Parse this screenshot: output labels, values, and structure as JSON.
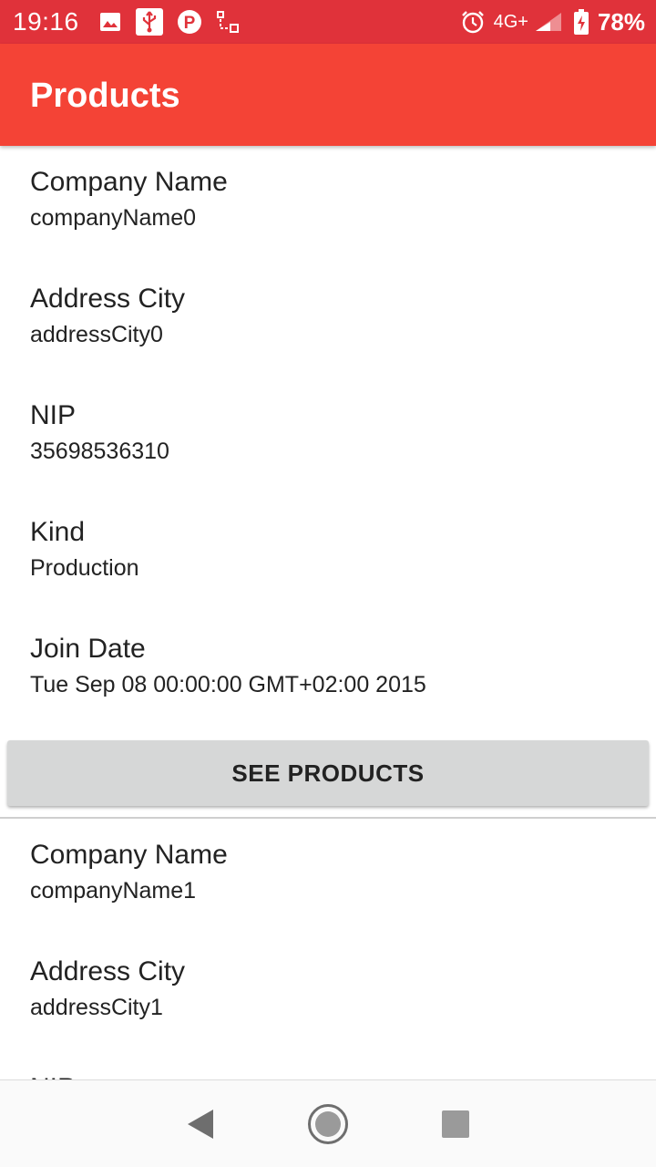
{
  "status_bar": {
    "time": "19:16",
    "network": "4G+",
    "battery": "78%",
    "left_icons": [
      "image-icon",
      "usb-icon",
      "parking-icon",
      "screencast-icon"
    ],
    "right_icons": [
      "alarm-icon",
      "signal-icon",
      "battery-charging-icon"
    ]
  },
  "app_bar": {
    "title": "Products",
    "color": "#f44336"
  },
  "companies": [
    {
      "fields": [
        {
          "label": "Company Name",
          "value": "companyName0"
        },
        {
          "label": "Address City",
          "value": "addressCity0"
        },
        {
          "label": "NIP",
          "value": "35698536310"
        },
        {
          "label": "Kind",
          "value": "Production"
        },
        {
          "label": "Join Date",
          "value": "Tue Sep 08 00:00:00 GMT+02:00 2015"
        }
      ],
      "button_label": "SEE PRODUCTS"
    },
    {
      "fields": [
        {
          "label": "Company Name",
          "value": "companyName1"
        },
        {
          "label": "Address City",
          "value": "addressCity1"
        },
        {
          "label": "NIP",
          "value": ""
        }
      ]
    }
  ],
  "nav_bar": {
    "icons": [
      "back-icon",
      "home-icon",
      "recents-icon"
    ]
  }
}
